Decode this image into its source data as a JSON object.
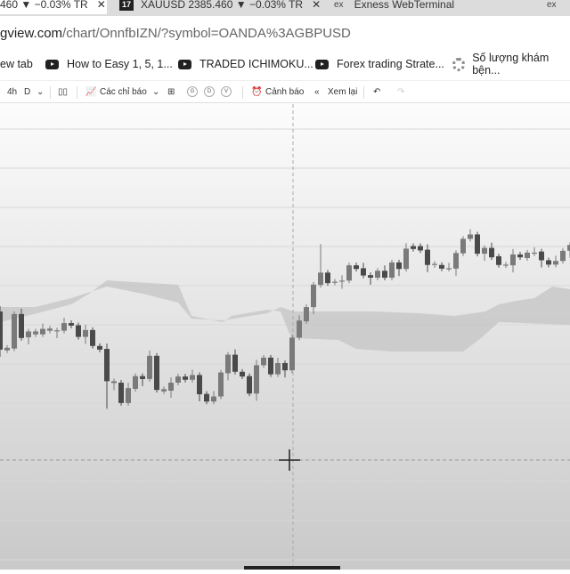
{
  "tabs": [
    {
      "label": "460 ▼ −0.03% TR",
      "active": true
    },
    {
      "label": "XAUUSD 2385.460 ▼ −0.03% TR",
      "icon": "tradingview-icon"
    },
    {
      "label": "Exness WebTerminal",
      "icon": "exness-icon"
    },
    {
      "icon": "exness-icon"
    }
  ],
  "address": {
    "host": "gview.com",
    "path": "/chart/OnnfbIZN/?symbol=OANDA%3AGBPUSD"
  },
  "bookmarks": [
    {
      "label": "ew tab"
    },
    {
      "label": "How to Easy 1, 5, 1...",
      "icon": "youtube-icon"
    },
    {
      "label": "TRADED ICHIMOKU...",
      "icon": "youtube-icon"
    },
    {
      "label": "Forex trading Strate...",
      "icon": "youtube-icon"
    },
    {
      "label": "Số lượng khám bện...",
      "icon": "gear-icon"
    }
  ],
  "toolbar": {
    "interval_4h": "4h",
    "interval_d": "D",
    "indicators": "Các chỉ báo",
    "g": "G",
    "d": "D",
    "v": "V",
    "alert": "Cảnh báo",
    "replay": "Xem lại"
  },
  "chart": {
    "symbol": "OANDA:GBPUSD",
    "timeframe": "4h",
    "type": "candlestick",
    "indicator": "Ichimoku cloud",
    "colors": {
      "candle_up": "#7a7a7a",
      "candle_down": "#4a4a4a",
      "cloud": "#c4c4c4"
    }
  }
}
